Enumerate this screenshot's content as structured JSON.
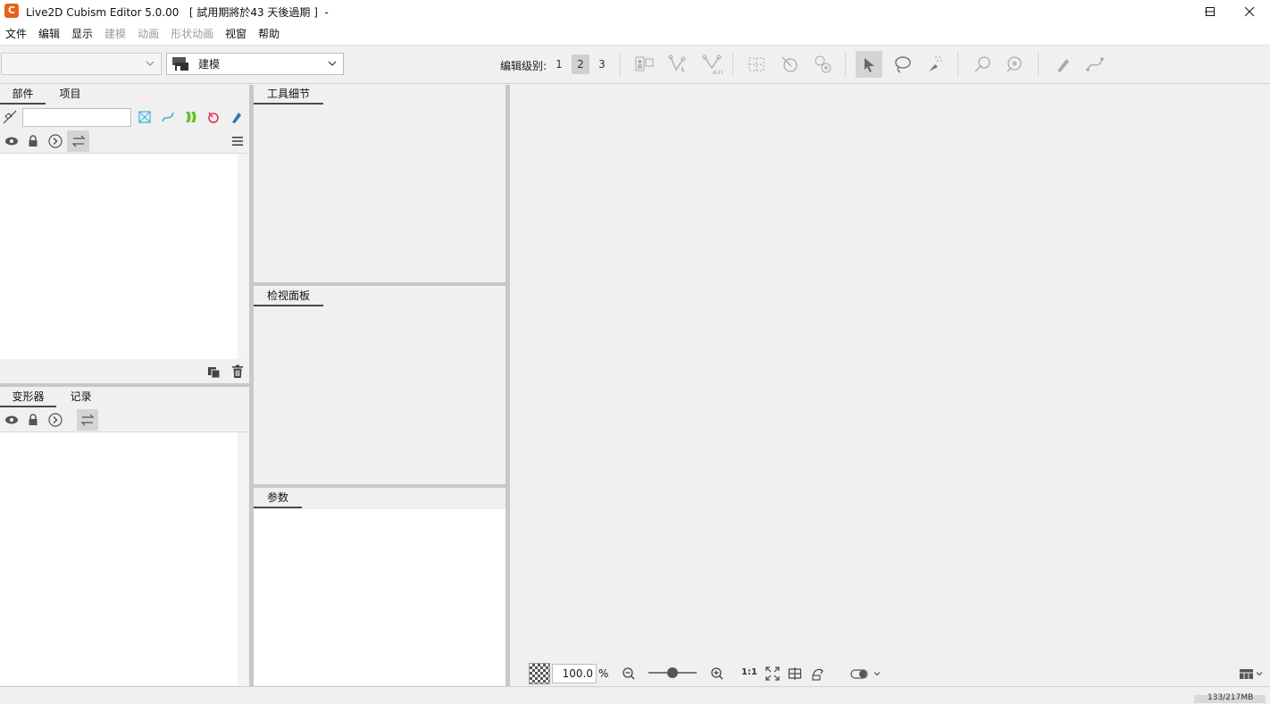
{
  "window": {
    "logo_glyph": "C",
    "title": "Live2D Cubism Editor 5.0.00   [ 試用期將於43 天後過期 ]  -",
    "controls": {
      "minimize_icon": "minimize-icon",
      "maximize_icon": "maximize-icon",
      "close_icon": "close-icon"
    }
  },
  "menu": {
    "items": [
      {
        "label": "文件",
        "enabled": true
      },
      {
        "label": "编辑",
        "enabled": true
      },
      {
        "label": "显示",
        "enabled": true
      },
      {
        "label": "建模",
        "enabled": false
      },
      {
        "label": "动画",
        "enabled": false
      },
      {
        "label": "形状动画",
        "enabled": false
      },
      {
        "label": "视窗",
        "enabled": true
      },
      {
        "label": "帮助",
        "enabled": true
      }
    ]
  },
  "toolbar": {
    "model_select_value": "",
    "workspace_select_value": "建模",
    "edit_level_label": "编辑级别:",
    "edit_levels": [
      "1",
      "2",
      "3"
    ],
    "active_edit_level": "2",
    "tools": [
      "texture-atlas-icon",
      "mesh-edit-icon",
      "auto-mesh-icon",
      "deformer-grid-icon",
      "glue-icon",
      "glue-auto-icon",
      "arrow-select-icon",
      "lasso-select-icon",
      "brush-select-icon",
      "rotation-deformer-icon",
      "warp-deformer-icon",
      "pen-icon",
      "curve-icon"
    ]
  },
  "parts_panel": {
    "tabs": [
      "部件",
      "项目"
    ],
    "active_tab": "部件",
    "search_placeholder": ""
  },
  "deformer_panel": {
    "tabs": [
      "变形器",
      "记录"
    ],
    "active_tab": "变形器"
  },
  "tool_details_panel": {
    "tab": "工具细节"
  },
  "inspector_panel": {
    "tab": "检视面板"
  },
  "parameters_panel": {
    "tab": "参数"
  },
  "canvas_toolbar": {
    "zoom_value": "100.0",
    "zoom_unit": "%",
    "zoom_slider_level": 0.5,
    "ratio_label": "1:1"
  },
  "status_bar": {
    "memory_text": "133/217MB"
  }
}
